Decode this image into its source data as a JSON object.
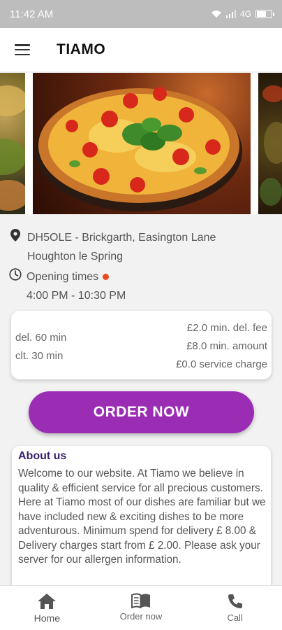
{
  "status_bar": {
    "time": "11:42 AM",
    "network": "4G"
  },
  "header": {
    "title": "TIAMO"
  },
  "location": {
    "line1": "DH5OLE - Brickgarth, Easington Lane",
    "line2": "Houghton le Spring"
  },
  "opening": {
    "label": "Opening times",
    "hours": "4:00 PM - 10:30 PM",
    "status_color": "#e8491d"
  },
  "fees": {
    "delivery_time": "del. 60 min",
    "collection_time": "clt. 30 min",
    "min_del_fee": "£2.0 min. del. fee",
    "min_amount": "£8.0 min. amount",
    "service_charge": "£0.0 service charge"
  },
  "order_button": {
    "label": "ORDER NOW",
    "color": "#9b2db5"
  },
  "about": {
    "title": "About us",
    "text": "Welcome to our website. At Tiamo we believe in quality & efficient service for all precious customers. Here at Tiamo most of our dishes are familiar but we have included new & exciting dishes to be more adventurous. Minimum spend for delivery £ 8.00 & Delivery charges start from £ 2.00. Please ask your server for our allergen information."
  },
  "bottom_nav": [
    {
      "label": "Home",
      "icon": "home-icon"
    },
    {
      "label": "Order now",
      "icon": "menu-book-icon"
    },
    {
      "label": "Call",
      "icon": "phone-icon"
    }
  ]
}
